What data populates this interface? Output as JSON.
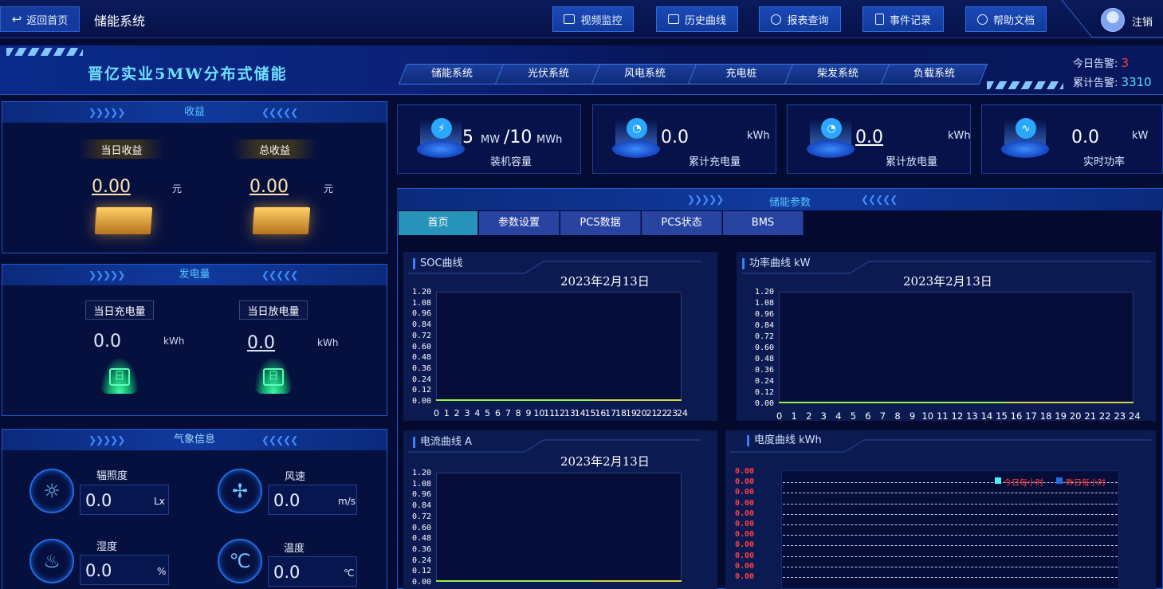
{
  "topbar": {
    "back_label": "返回首页",
    "system_title": "储能系统",
    "buttons": [
      "视频监控",
      "历史曲线",
      "报表查询",
      "事件记录",
      "帮助文档"
    ],
    "logout_label": "注销"
  },
  "banner": {
    "title": "晋亿实业5MW分布式储能",
    "tabs": [
      "储能系统",
      "光伏系统",
      "风电系统",
      "充电桩",
      "柴发系统",
      "负载系统"
    ]
  },
  "alarms": {
    "today_label": "今日告警:",
    "today_value": "3",
    "total_label": "累计告警:",
    "total_value": "3310"
  },
  "income": {
    "title": "收益",
    "daily_label": "当日收益",
    "daily_value": "0.00",
    "daily_unit": "元",
    "total_label": "总收益",
    "total_value": "0.00",
    "total_unit": "元"
  },
  "generation": {
    "title": "发电量",
    "charge_label": "当日充电量",
    "charge_value": "0.0",
    "charge_unit": "kWh",
    "discharge_label": "当日放电量",
    "discharge_value": "0.0",
    "discharge_unit": "kWh",
    "icon_glyph": "日"
  },
  "weather": {
    "title": "气象信息",
    "items": [
      {
        "label": "辐照度",
        "value": "0.0",
        "unit": "Lx"
      },
      {
        "label": "风速",
        "value": "0.0",
        "unit": "m/s"
      },
      {
        "label": "湿度",
        "value": "0.0",
        "unit": "%"
      },
      {
        "label": "温度",
        "value": "0.0",
        "unit": "℃"
      }
    ]
  },
  "kpis": {
    "capacity": {
      "power": "5",
      "power_unit": "MW",
      "sep": "/10",
      "energy_unit": "MWh",
      "label": "装机容量"
    },
    "charged": {
      "value": "0.0",
      "unit": "kWh",
      "label": "累计充电量"
    },
    "discharged": {
      "value": "0.0",
      "unit": "kWh",
      "label": "累计放电量"
    },
    "power": {
      "value": "0.0",
      "unit": "kW",
      "label": "实时功率"
    }
  },
  "params": {
    "title": "储能参数",
    "tabs": [
      "首页",
      "参数设置",
      "PCS数据",
      "PCS状态",
      "BMS"
    ],
    "active_tab": "首页"
  },
  "charts": {
    "soc": {
      "title": "SOC曲线",
      "date": "2023年2月13日"
    },
    "power": {
      "title": "功率曲线  kW",
      "date": "2023年2月13日"
    },
    "current": {
      "title": "电流曲线  A",
      "date": "2023年2月13日"
    },
    "energy": {
      "title": "电度曲线  kWh",
      "legend": [
        "今日每小时",
        "昨日每小时"
      ]
    }
  },
  "chart_data": [
    {
      "type": "line",
      "title": "SOC曲线",
      "subtitle": "2023年2月13日",
      "x": [
        "0",
        "1",
        "2",
        "3",
        "4",
        "5",
        "6",
        "7",
        "8",
        "9",
        "10",
        "11",
        "12",
        "13",
        "14",
        "15",
        "16",
        "17",
        "18",
        "19",
        "20",
        "21",
        "22",
        "23",
        "24"
      ],
      "y_ticks": [
        "0.00",
        "0.12",
        "0.24",
        "0.36",
        "0.48",
        "0.60",
        "0.72",
        "0.84",
        "0.96",
        "1.08",
        "1.20"
      ],
      "ylim": [
        0,
        1.2
      ],
      "series": [
        {
          "values": [
            0,
            0,
            0,
            0,
            0,
            0,
            0,
            0,
            0,
            0,
            0,
            0,
            0,
            0,
            0,
            0,
            0,
            0,
            0,
            0,
            0,
            0,
            0,
            0,
            0
          ]
        }
      ],
      "x_tick_labels": "0 1 2 3 4 5 6 7 8 9 10111213141516171819202122232 4"
    },
    {
      "type": "line",
      "title": "功率曲线  kW",
      "subtitle": "2023年2月13日",
      "x": [
        "0",
        "1",
        "2",
        "3",
        "4",
        "5",
        "6",
        "7",
        "8",
        "9",
        "10",
        "11",
        "12",
        "13",
        "14",
        "15",
        "16",
        "17",
        "18",
        "19",
        "20",
        "21",
        "22",
        "23",
        "24"
      ],
      "y_ticks": [
        "0.00",
        "0.12",
        "0.24",
        "0.36",
        "0.48",
        "0.60",
        "0.72",
        "0.84",
        "0.96",
        "1.08",
        "1.20"
      ],
      "ylim": [
        0,
        1.2
      ],
      "series": [
        {
          "values": [
            0,
            0,
            0,
            0,
            0,
            0,
            0,
            0,
            0,
            0,
            0,
            0,
            0,
            0,
            0,
            0,
            0,
            0,
            0,
            0,
            0,
            0,
            0,
            0,
            0
          ]
        }
      ]
    },
    {
      "type": "line",
      "title": "电流曲线  A",
      "subtitle": "2023年2月13日",
      "y_ticks": [
        "0.00",
        "0.12",
        "0.24",
        "0.36",
        "0.48",
        "0.60",
        "0.72",
        "0.84",
        "0.96",
        "1.08",
        "1.20"
      ],
      "ylim": [
        0,
        1.2
      ],
      "series": [
        {
          "values": [
            0,
            0,
            0,
            0,
            0,
            0,
            0,
            0,
            0,
            0,
            0,
            0,
            0,
            0,
            0,
            0,
            0,
            0,
            0,
            0,
            0,
            0,
            0,
            0,
            0
          ]
        }
      ]
    },
    {
      "type": "line",
      "title": "电度曲线  kWh",
      "y_ticks": [
        "0.00",
        "0.00",
        "0.00",
        "0.00",
        "0.00",
        "0.00",
        "0.00",
        "0.00",
        "0.00",
        "0.00",
        "0.00",
        "0.00"
      ],
      "series": [
        {
          "name": "今日每小时",
          "values": []
        },
        {
          "name": "昨日每小时",
          "values": []
        }
      ]
    }
  ]
}
